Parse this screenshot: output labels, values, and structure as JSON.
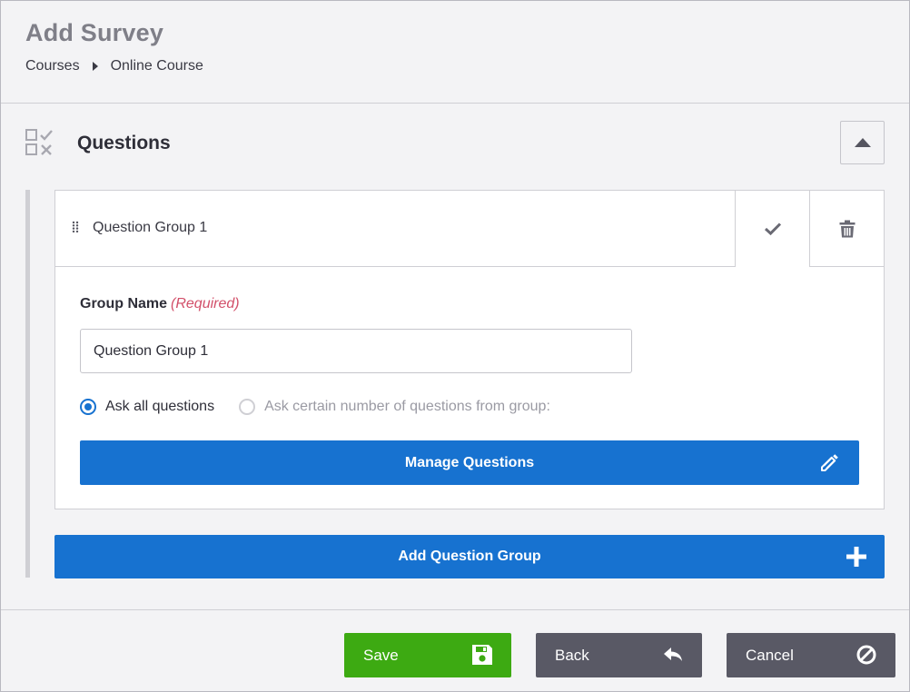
{
  "header": {
    "title": "Add Survey",
    "breadcrumb": [
      "Courses",
      "Online Course"
    ]
  },
  "section": {
    "title": "Questions",
    "icon": "checklist-icon",
    "collapse_icon": "caret-up-icon"
  },
  "group": {
    "header_label": "Question Group 1",
    "field_label": "Group Name",
    "field_required": "(Required)",
    "name_value": "Question Group 1",
    "radio_all_label": "Ask all questions",
    "radio_certain_label": "Ask certain number of questions from group:",
    "radio_selected": "all",
    "manage_label": "Manage Questions"
  },
  "add_group_label": "Add Question Group",
  "footer": {
    "save_label": "Save",
    "back_label": "Back",
    "cancel_label": "Cancel"
  },
  "colors": {
    "primary_blue": "#1772d0",
    "save_green": "#3daa12",
    "dark_button": "#595965",
    "required_red": "#d2506a"
  }
}
